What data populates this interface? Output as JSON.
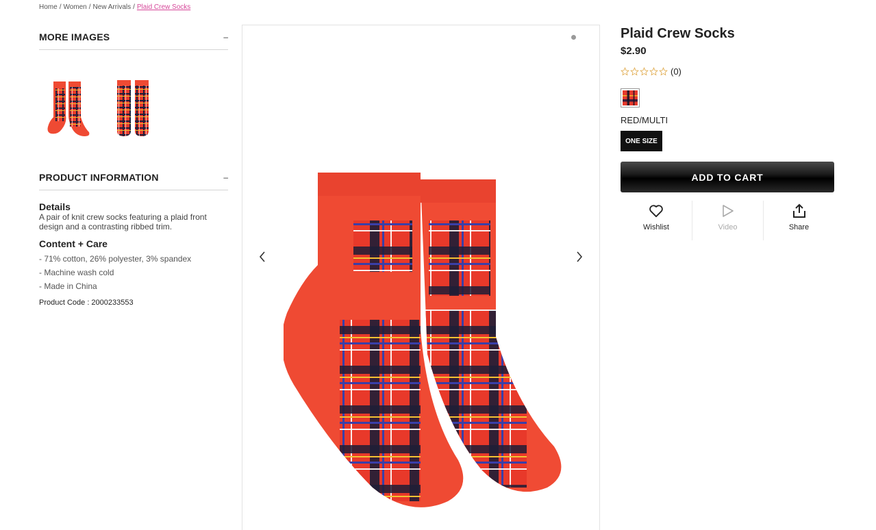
{
  "breadcrumb": {
    "items": [
      "Home",
      "Women",
      "New Arrivals"
    ],
    "current": "Plaid Crew Socks",
    "separator": "/"
  },
  "more_images": {
    "title": "MORE IMAGES",
    "toggle": "–"
  },
  "product_information": {
    "title": "PRODUCT INFORMATION",
    "toggle": "–",
    "details_title": "Details",
    "details_text": "A pair of knit crew socks featuring a plaid front design and a contrasting ribbed trim.",
    "care_title": "Content + Care",
    "care_items": [
      "- 71% cotton, 26% polyester, 3% spandex",
      "- Machine wash cold",
      "- Made in China"
    ],
    "product_code": "Product Code : 2000233553"
  },
  "product": {
    "title": "Plaid Crew Socks",
    "price": "$2.90",
    "rating_stars": 0,
    "review_count": "(0)",
    "color_name": "RED/MULTI",
    "size_label": "ONE SIZE",
    "add_to_cart": "ADD TO CART"
  },
  "actions": {
    "wishlist": "Wishlist",
    "video": "Video",
    "share": "Share"
  },
  "icons": {
    "prev": "chevron-left-icon",
    "next": "chevron-right-icon",
    "wishlist": "heart-icon",
    "video": "play-icon",
    "share": "share-icon",
    "star": "star-outline-icon"
  },
  "colors": {
    "accent_link": "#d6489a",
    "sock_red": "#ef4a33",
    "star_outline": "#e0a94a",
    "button_black": "#111111"
  }
}
